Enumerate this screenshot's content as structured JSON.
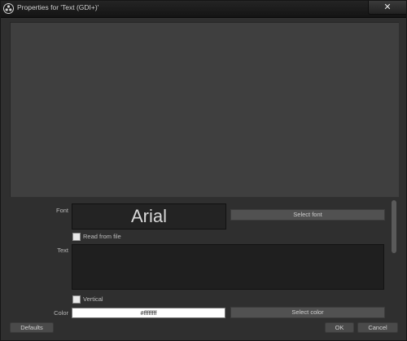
{
  "window": {
    "title": "Properties for 'Text (GDI+)'",
    "close_glyph": "✕"
  },
  "properties": {
    "font_label": "Font",
    "font_preview": "Arial",
    "select_font_label": "Select font",
    "read_from_file_label": "Read from file",
    "read_from_file_checked": false,
    "text_label": "Text",
    "text_value": "",
    "vertical_label": "Vertical",
    "vertical_checked": false,
    "color_label": "Color",
    "color_value": "#ffffffff",
    "select_color_label": "Select color"
  },
  "footer": {
    "defaults_label": "Defaults",
    "ok_label": "OK",
    "cancel_label": "Cancel"
  },
  "icons": {
    "app_icon": "obs-logo-icon",
    "close_icon": "close-icon"
  }
}
